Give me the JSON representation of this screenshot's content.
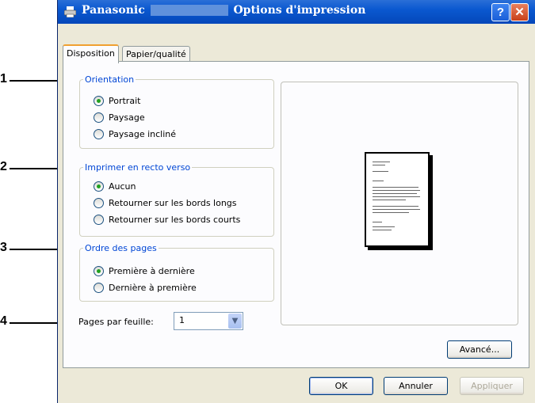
{
  "window": {
    "title_brand": "Panasonic",
    "title_suffix": "Options d'impression",
    "help_label": "?",
    "close_label": "✕"
  },
  "tabs": [
    {
      "label": "Disposition",
      "active": true
    },
    {
      "label": "Papier/qualité",
      "active": false
    }
  ],
  "callouts": [
    "1",
    "2",
    "3",
    "4"
  ],
  "orientation": {
    "legend": "Orientation",
    "options": [
      {
        "label": "Portrait",
        "checked": true
      },
      {
        "label": "Paysage",
        "checked": false
      },
      {
        "label": "Paysage incliné",
        "checked": false
      }
    ]
  },
  "duplex": {
    "legend": "Imprimer en recto verso",
    "options": [
      {
        "label": "Aucun",
        "checked": true
      },
      {
        "label": "Retourner sur les bords longs",
        "checked": false
      },
      {
        "label": "Retourner sur les bords courts",
        "checked": false
      }
    ]
  },
  "page_order": {
    "legend": "Ordre des pages",
    "options": [
      {
        "label": "Première à dernière",
        "checked": true
      },
      {
        "label": "Dernière à première",
        "checked": false
      }
    ]
  },
  "pages_per_sheet": {
    "label": "Pages par feuille:",
    "value": "1"
  },
  "buttons": {
    "advanced": "Avancé...",
    "ok": "OK",
    "cancel": "Annuler",
    "apply": "Appliquer"
  },
  "colors": {
    "titlebar": "#0a58d0",
    "group_legend": "#0046d5",
    "radio_checked": "#21a121",
    "dialog_bg": "#ece9d8"
  }
}
